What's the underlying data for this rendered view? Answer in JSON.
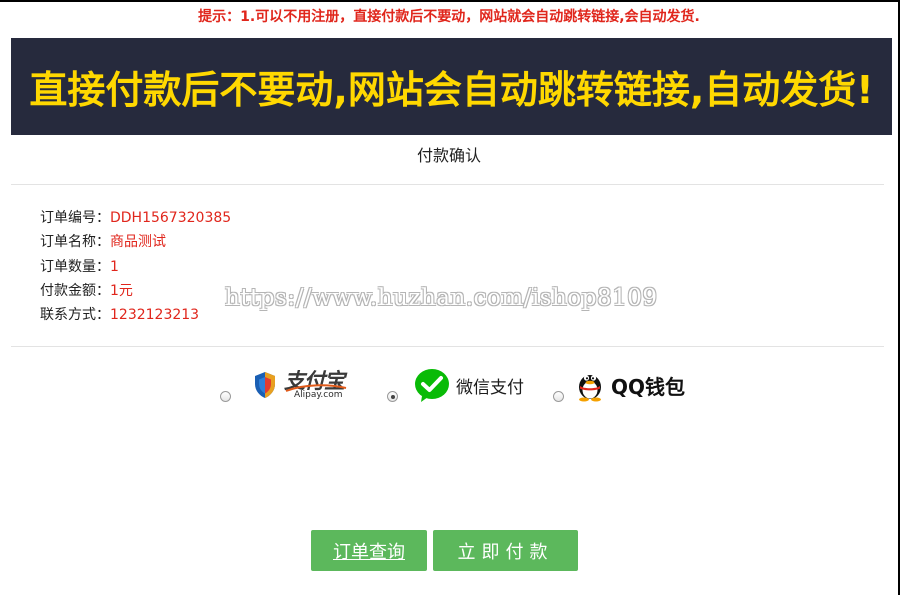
{
  "notice": "提示：1.可以不用注册，直接付款后不要动，网站就会自动跳转链接,会自动发货.",
  "banner": "直接付款后不要动,网站会自动跳转链接,自动发货!",
  "confirm_title": "付款确认",
  "order": {
    "number_label": "订单编号：",
    "number_value": "DDH1567320385",
    "name_label": "订单名称：",
    "name_value": "商品测试",
    "qty_label": "订单数量：",
    "qty_value": "1",
    "amount_label": "付款金额：",
    "amount_value": "1元",
    "contact_label": "联系方式：",
    "contact_value": "1232123213"
  },
  "watermark": "https://www.huzhan.com/ishop8109",
  "payment": {
    "alipay_text": "支付宝",
    "alipay_sub": "Alipay.com",
    "wechat_text": "微信支付",
    "qq_text": "QQ钱包",
    "selected": "wechat"
  },
  "buttons": {
    "query": "订单查询",
    "pay": "立即付款"
  },
  "colors": {
    "accent_red": "#e0261c",
    "banner_bg": "#262a3d",
    "banner_text": "#ffd800",
    "button_green": "#5cb85c",
    "wechat_green": "#09bb07",
    "alipay_blue": "#1a8de9"
  }
}
